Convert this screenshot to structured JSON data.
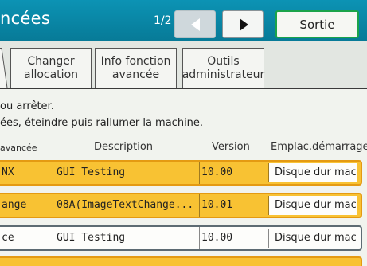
{
  "header": {
    "title": "ncées",
    "page_indicator": "1/2",
    "prev_icon": "triangle-left",
    "next_icon": "triangle-right",
    "exit_label": "Sortie"
  },
  "tabs": [
    {
      "label_line1": "Changer",
      "label_line2": "allocation"
    },
    {
      "label_line1": "Info fonction",
      "label_line2": "avancée"
    },
    {
      "label_line1": "Outils",
      "label_line2": "administrateur"
    }
  ],
  "messages": {
    "line1": "ou arrêter.",
    "line2": "ées, éteindre puis rallumer la machine."
  },
  "table": {
    "columns": {
      "name": "avancée",
      "description": "Description",
      "version": "Version",
      "location": "Emplac.démarrage"
    },
    "rows": [
      {
        "name": "NX",
        "description": "GUI Testing",
        "version": "10.00",
        "location": "Disque dur mach",
        "selected": true
      },
      {
        "name": "ange",
        "description": "08A(ImageTextChange...",
        "version": "10.01",
        "location": "Disque dur mach",
        "selected": true
      },
      {
        "name": "ce",
        "description": "GUI Testing",
        "version": "10.00",
        "location": "Disque dur mach",
        "selected": false
      }
    ]
  },
  "colors": {
    "titlebar": "#0a89a8",
    "selected_row": "#f8c233",
    "exit_border": "#1aa34a"
  }
}
